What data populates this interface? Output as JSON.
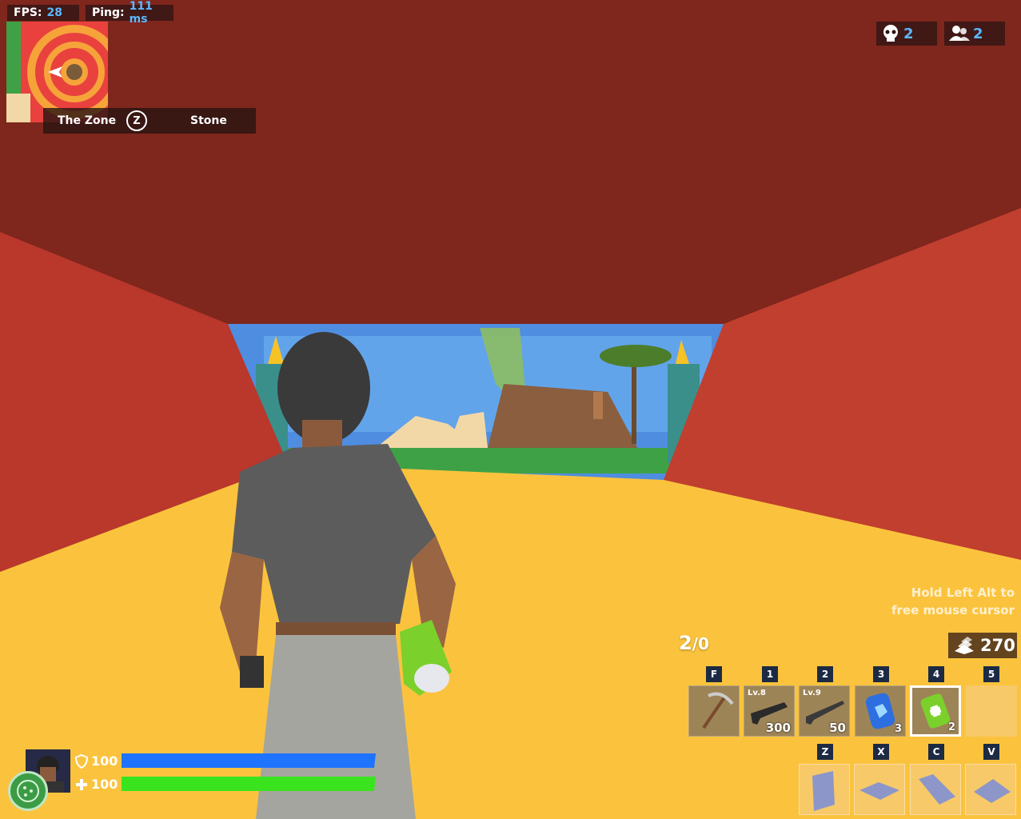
{
  "perf": {
    "fps_label": "FPS:",
    "fps_value": "28",
    "ping_label": "Ping:",
    "ping_value": "111 ms"
  },
  "zone": {
    "label": "The Zone",
    "key": "Z",
    "material": "Stone"
  },
  "counters": {
    "kills": "2",
    "players": "2"
  },
  "hint": {
    "line1": "Hold Left Alt to",
    "line2": "free mouse cursor"
  },
  "ammo": {
    "clip": "2",
    "reserve": "/0"
  },
  "materials": {
    "count": "270"
  },
  "hotbar": [
    {
      "key": "F",
      "item": "pickaxe-icon"
    },
    {
      "key": "1",
      "level": "Lv.8",
      "qty": "300",
      "item": "assault-rifle-icon"
    },
    {
      "key": "2",
      "level": "Lv.9",
      "qty": "50",
      "item": "shotgun-icon"
    },
    {
      "key": "3",
      "qty": "3",
      "item": "shield-potion-icon"
    },
    {
      "key": "4",
      "qty": "2",
      "item": "health-can-icon"
    },
    {
      "key": "5",
      "item": ""
    }
  ],
  "build": [
    {
      "key": "Z",
      "item": "wall-icon"
    },
    {
      "key": "X",
      "item": "floor-icon"
    },
    {
      "key": "C",
      "item": "ramp-icon"
    },
    {
      "key": "V",
      "item": "cone-icon"
    }
  ],
  "player": {
    "shield": "100",
    "health": "100",
    "shield_fraction": 1.0,
    "health_fraction": 1.0
  },
  "colors": {
    "accent": "#5ab8ff",
    "shield_bar": "#1e73ff",
    "health_bar": "#39e41f"
  }
}
